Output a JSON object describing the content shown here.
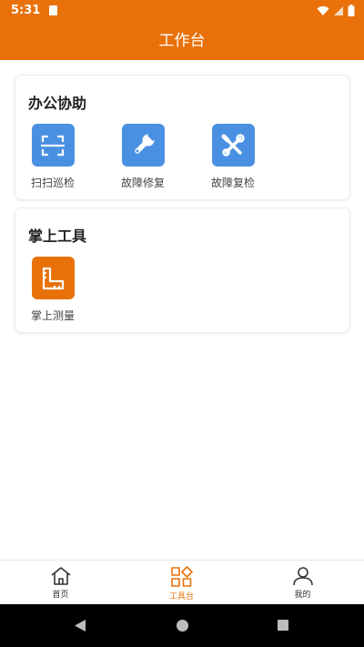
{
  "status_bar": {
    "time": "5:31"
  },
  "header": {
    "title": "工作台"
  },
  "sections": [
    {
      "title": "办公协助",
      "items": [
        {
          "label": "扫扫巡检",
          "icon": "scan-icon",
          "color": "#4a90e2"
        },
        {
          "label": "故障修复",
          "icon": "wrench-icon",
          "color": "#4a90e2"
        },
        {
          "label": "故障复检",
          "icon": "tools-icon",
          "color": "#4a90e2"
        }
      ]
    },
    {
      "title": "掌上工具",
      "items": [
        {
          "label": "掌上测量",
          "icon": "ruler-icon",
          "color": "#e8710a"
        }
      ]
    }
  ],
  "tab_bar": {
    "tabs": [
      {
        "label": "首页",
        "icon": "home-icon",
        "active": false
      },
      {
        "label": "工具台",
        "icon": "grid-icon",
        "active": true
      },
      {
        "label": "我的",
        "icon": "user-icon",
        "active": false
      }
    ]
  },
  "colors": {
    "accent": "#e8710a",
    "icon_blue": "#4a90e2"
  }
}
